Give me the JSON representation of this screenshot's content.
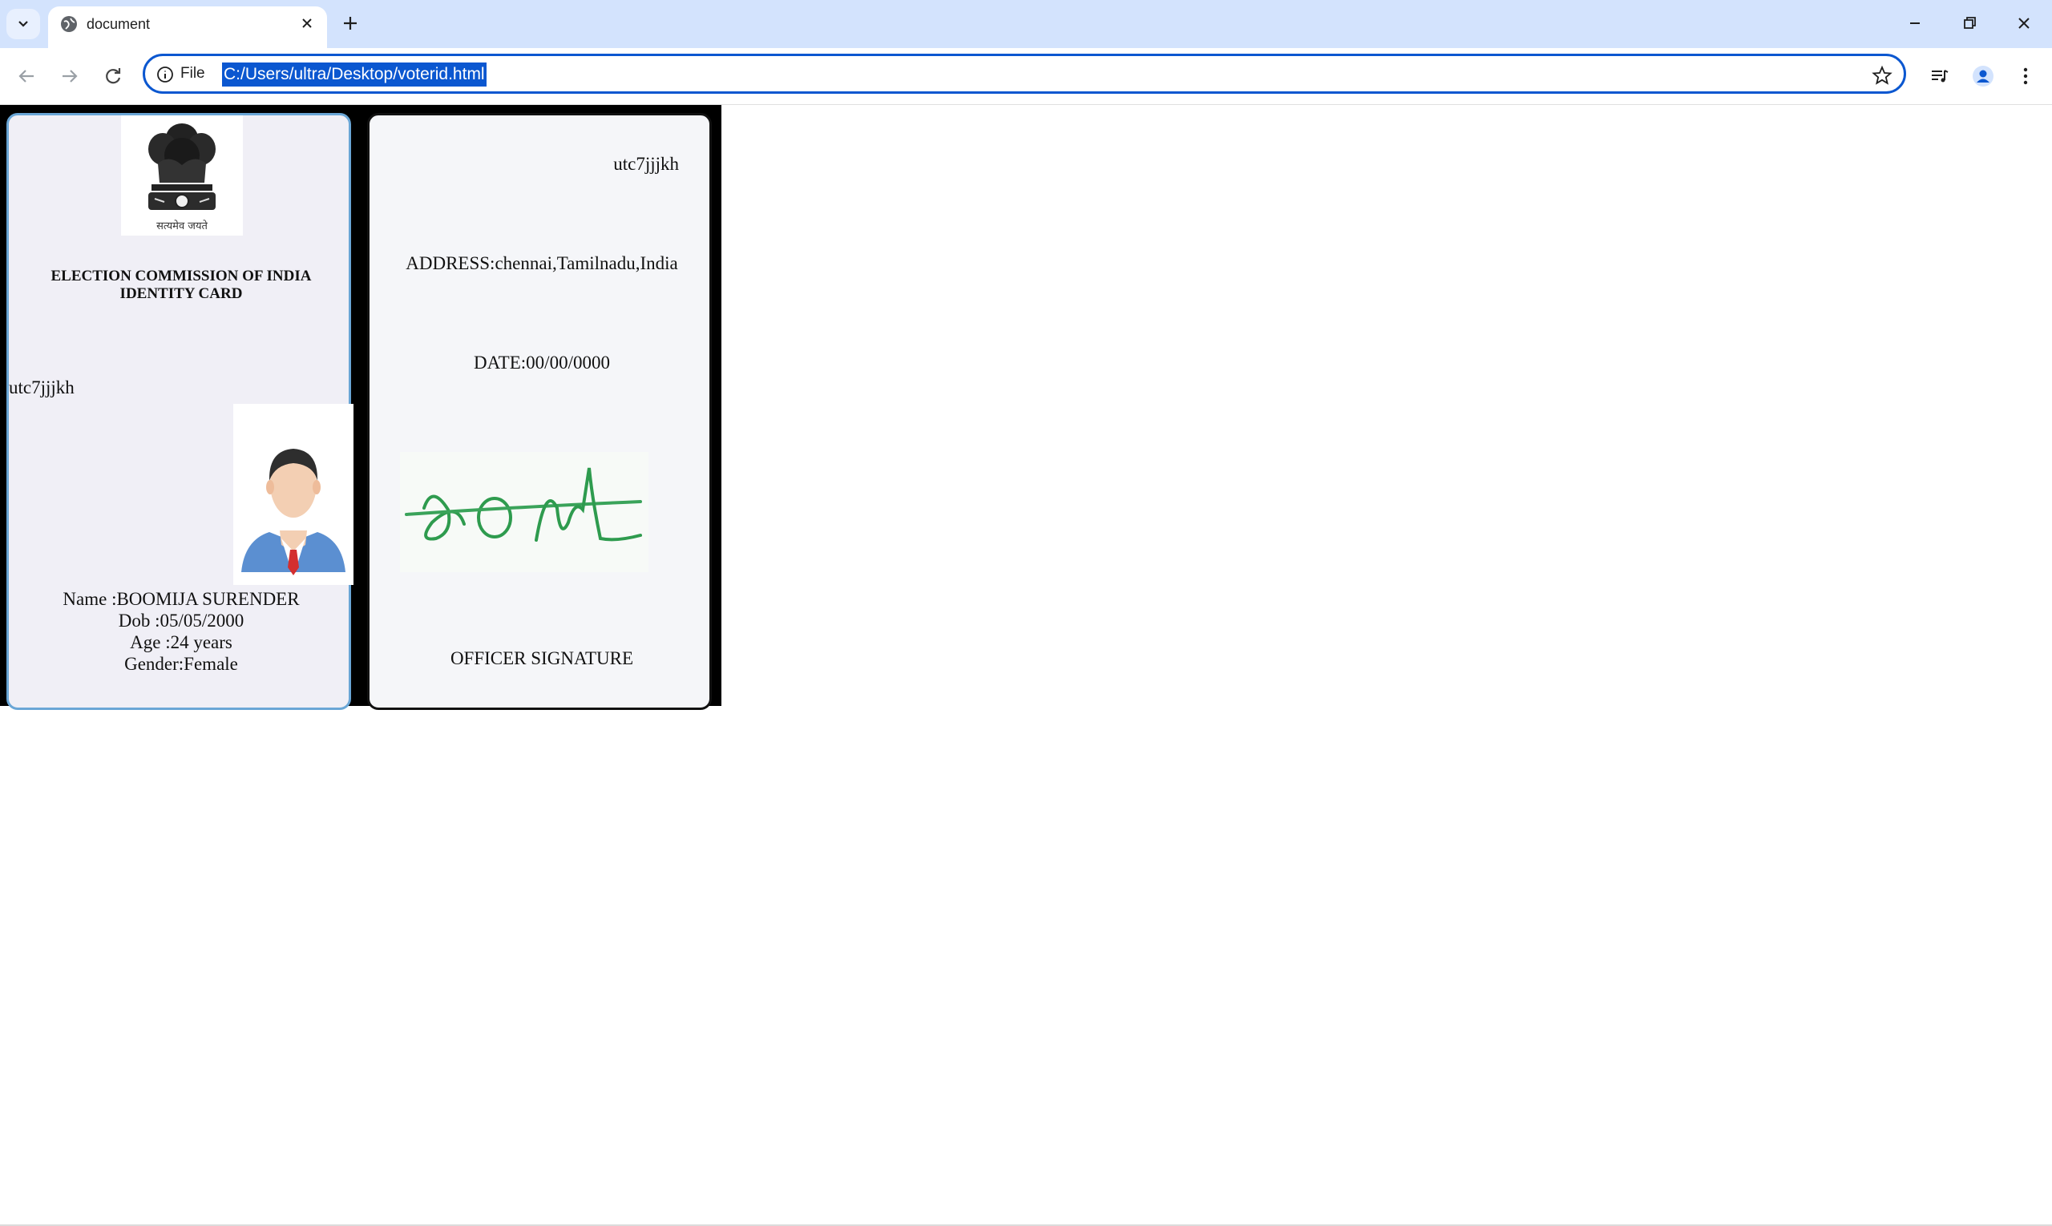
{
  "browser": {
    "tab_title": "document",
    "omnibox_scheme": "File",
    "url": "C:/Users/ultra/Desktop/voterid.html"
  },
  "card_front": {
    "title_line1": "ELECTION COMMISSION OF INDIA",
    "title_line2": "IDENTITY CARD",
    "emblem_motto": "सत्यमेव जयते",
    "id_number": "utc7jjjkh",
    "name": "Name :BOOMIJA SURENDER",
    "dob": "Dob :05/05/2000",
    "age": "Age :24 years",
    "gender": "Gender:Female"
  },
  "card_back": {
    "id_number": "utc7jjjkh",
    "address": "ADDRESS:chennai,Tamilnadu,India",
    "date": "DATE:00/00/0000",
    "officer_label": "OFFICER SIGNATURE"
  },
  "colors": {
    "tabbar": "#d3e3fd",
    "omnibox_border": "#0b57d0",
    "selection": "#0b57d0",
    "front_card_bg": "#f0eff6",
    "front_card_border": "#6aa6d6",
    "signature_ink": "#2e9b4e"
  }
}
